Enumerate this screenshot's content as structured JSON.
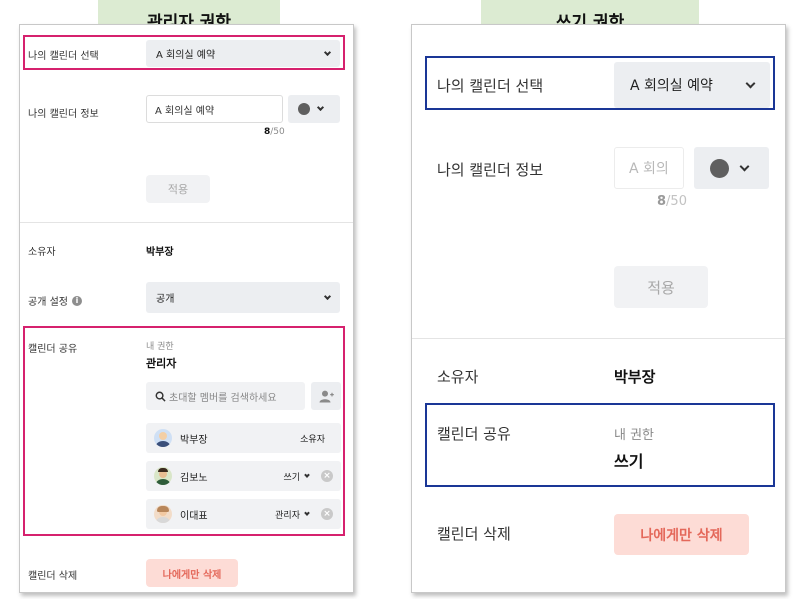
{
  "admin": {
    "banner": "관리자 권한",
    "select_calendar_label": "나의 캘린더 선택",
    "select_calendar_value": "A 회의실 예약",
    "calendar_info_label": "나의 캘린더 정보",
    "calendar_name_value": "A 회의실 예약",
    "char_count_current": "8",
    "char_count_max": "/50",
    "apply_button": "적용",
    "owner_label": "소유자",
    "owner_value": "박부장",
    "public_setting_label": "공개 설정",
    "public_setting_value": "공개",
    "share_label": "캘린더 공유",
    "my_permission_label": "내 권한",
    "my_permission_value": "관리자",
    "search_placeholder": "초대할 멤버를 검색하세요",
    "members": [
      {
        "name": "박부장",
        "role": "소유자"
      },
      {
        "name": "김보노",
        "role": "쓰기"
      },
      {
        "name": "이대표",
        "role": "관리자"
      }
    ],
    "delete_label": "캘린더 삭제",
    "delete_button": "나에게만 삭제"
  },
  "writer": {
    "banner": "쓰기 권한",
    "select_calendar_label": "나의 캘린더 선택",
    "select_calendar_value": "A 회의실 예약",
    "calendar_info_label": "나의 캘린더 정보",
    "calendar_name_value": "A 회의",
    "char_count_current": "8",
    "char_count_max": "/50",
    "apply_button": "적용",
    "owner_label": "소유자",
    "owner_value": "박부장",
    "share_label": "캘린더 공유",
    "my_permission_label": "내 권한",
    "my_permission_value": "쓰기",
    "delete_label": "캘린더 삭제",
    "delete_button": "나에게만 삭제"
  },
  "colors": {
    "banner_bg": "#dcebd2",
    "highlight_admin": "#d6216e",
    "highlight_writer": "#1a3696",
    "danger_bg": "#fddcd6",
    "danger_text": "#e4685a",
    "calendar_color": "#5f5f5f"
  }
}
